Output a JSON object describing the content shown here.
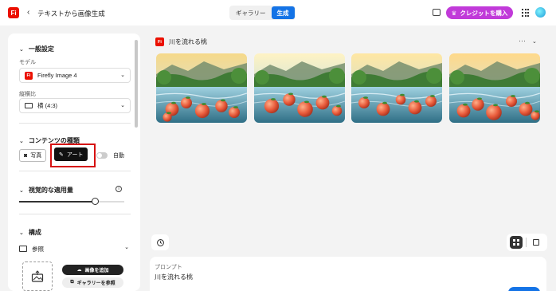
{
  "header": {
    "logo_text": "Fi",
    "title": "テキストから画像生成",
    "tabs": [
      {
        "label": "ギャラリー",
        "active": false
      },
      {
        "label": "生成",
        "active": true
      }
    ],
    "credit_button": "クレジットを購入",
    "brand_color": "#eb1000",
    "accent_color": "#1473e6",
    "credit_color": "#c13ad9"
  },
  "sidebar": {
    "general": {
      "heading": "一般設定",
      "model_label": "モデル",
      "model_value": "Firefly Image 4",
      "ratio_label": "縦横比",
      "ratio_value": "横 (4:3)"
    },
    "content_type": {
      "heading": "コンテンツの種類",
      "photo": "写真",
      "art": "アート",
      "auto": "自動",
      "selected": "アート"
    },
    "visual": {
      "heading": "視覚的な適用量",
      "intensity": 0.72
    },
    "composition": {
      "heading": "構成",
      "reference_label": "参照",
      "add_image": "画像を追加",
      "browse_gallery": "ギャラリーを参照"
    }
  },
  "main": {
    "generation_title": "川を流れる桃",
    "image_count": 4,
    "prompt_label": "プロンプト",
    "prompt_text": "川を流れる桃"
  }
}
